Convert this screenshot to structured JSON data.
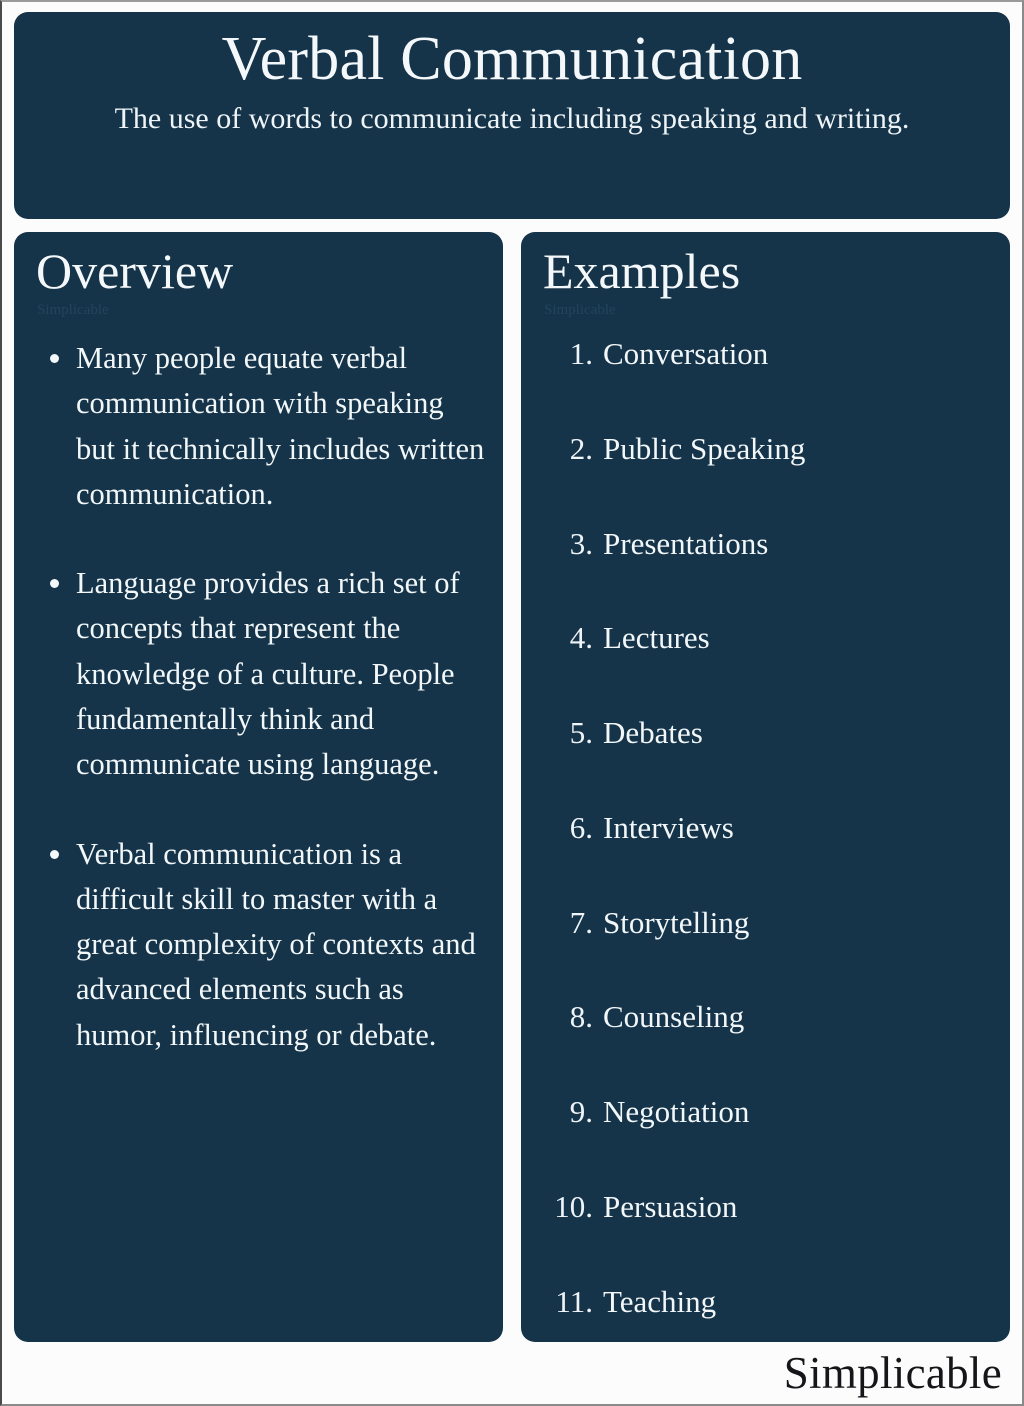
{
  "colors": {
    "panel_navy": "#153449",
    "page_background": "#fdfcfc",
    "text_light": "#f2f7f9",
    "watermark": "#22455c",
    "footer_text": "#16161a"
  },
  "header": {
    "title": "Verbal Communication",
    "subtitle": "The use of words to communicate including speaking and writing."
  },
  "overview": {
    "heading": "Overview",
    "watermark": "Simplicable",
    "bullets": [
      "Many people equate verbal communication with speaking but it technically includes written communication.",
      "Language provides a rich set of concepts that represent the knowledge of a culture. People fundamentally think and communicate using language.",
      "Verbal communication is a difficult skill to master with a great complexity of contexts and advanced elements such as humor, influencing or debate."
    ]
  },
  "examples": {
    "heading": "Examples",
    "watermark": "Simplicable",
    "items": [
      {
        "number": "1.",
        "label": "Conversation"
      },
      {
        "number": "2.",
        "label": "Public Speaking"
      },
      {
        "number": "3.",
        "label": "Presentations"
      },
      {
        "number": "4.",
        "label": "Lectures"
      },
      {
        "number": "5.",
        "label": "Debates"
      },
      {
        "number": "6.",
        "label": "Interviews"
      },
      {
        "number": "7.",
        "label": "Storytelling"
      },
      {
        "number": "8.",
        "label": "Counseling"
      },
      {
        "number": "9.",
        "label": "Negotiation"
      },
      {
        "number": "10.",
        "label": "Persuasion"
      },
      {
        "number": "11.",
        "label": "Teaching"
      }
    ]
  },
  "footer": {
    "logo": "Simplicable"
  }
}
